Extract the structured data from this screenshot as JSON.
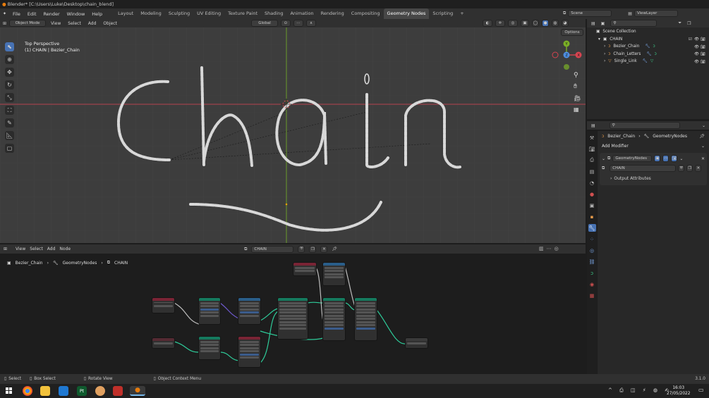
{
  "window": {
    "title": "Blender* [C:\\Users\\Luke\\Desktop\\chain_blend]"
  },
  "menu": {
    "items": [
      "File",
      "Edit",
      "Render",
      "Window",
      "Help"
    ]
  },
  "workspaces": [
    "Layout",
    "Modeling",
    "Sculpting",
    "UV Editing",
    "Texture Paint",
    "Shading",
    "Animation",
    "Rendering",
    "Compositing",
    "Geometry Nodes",
    "Scripting"
  ],
  "active_workspace": "Geometry Nodes",
  "scene": {
    "name": "Scene",
    "view_layer": "ViewLayer"
  },
  "viewport": {
    "mode": "Object Mode",
    "menu": [
      "View",
      "Select",
      "Add",
      "Object"
    ],
    "transform": "Global",
    "options_label": "Options",
    "perspective": "Top Perspective",
    "object_info": "(1) CHAIN | Bezier_Chain",
    "gizmo": {
      "x": "X",
      "y": "Y",
      "z": "Z"
    }
  },
  "outliner": {
    "root": "Scene Collection",
    "collection": "CHAIN",
    "items": [
      "Bezier_Chain",
      "Chain_Letters",
      "Single_Link"
    ]
  },
  "properties": {
    "breadcrumb_object": "Bezier_Chain",
    "breadcrumb_modifier": "GeometryNodes",
    "add_modifier": "Add Modifier",
    "modifier_name": "GeometryNodes",
    "node_group": "CHAIN",
    "output_attributes": "Output Attributes"
  },
  "node_editor": {
    "menu": [
      "View",
      "Select",
      "Add",
      "Node"
    ],
    "node_group": "CHAIN",
    "breadcrumb": [
      "Bezier_Chain",
      "GeometryNodes",
      "CHAIN"
    ]
  },
  "statusbar": {
    "items": [
      "Select",
      "Box Select",
      "Rotate View",
      "Object Context Menu"
    ],
    "version": "3.1.0"
  },
  "taskbar": {
    "time": "16:03",
    "date": "27/05/2022"
  },
  "colors": {
    "accent": "#4772b3",
    "red_axis": "#d64450",
    "green_axis": "#7bb026",
    "node_link": "#2ecc9a"
  }
}
